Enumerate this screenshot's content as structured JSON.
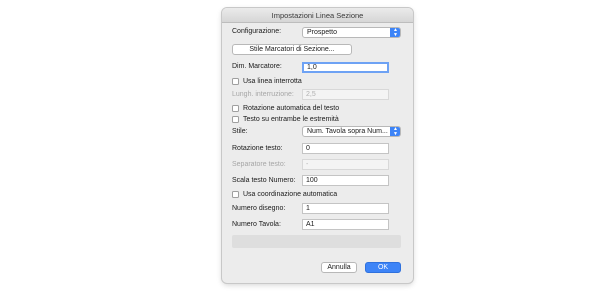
{
  "dialog": {
    "title": "Impostazioni Linea Sezione",
    "configurazione": {
      "label": "Configurazione:",
      "value": "Prospetto"
    },
    "stile_marcatori_button": "Stile Marcatori di Sezione...",
    "dim_marcatore": {
      "label": "Dim. Marcatore:",
      "value": "1,0"
    },
    "usa_linea_interrotta": {
      "label": "Usa linea interrotta",
      "checked": false
    },
    "lungh_interruzione": {
      "label": "Lungh. interruzione:",
      "value": "2,5"
    },
    "rotazione_automatica": {
      "label": "Rotazione automatica del testo",
      "checked": false
    },
    "testo_entrambe": {
      "label": "Testo su entrambe le estremità",
      "checked": false
    },
    "stile": {
      "label": "Stile:",
      "value": "Num. Tavola sopra Num..."
    },
    "rotazione_testo": {
      "label": "Rotazione testo:",
      "value": "0"
    },
    "separatore_testo": {
      "label": "Separatore testo:",
      "value": "-"
    },
    "scala_testo": {
      "label": "Scala testo Numero:",
      "value": "100"
    },
    "usa_coordinazione": {
      "label": "Usa coordinazione automatica",
      "checked": false
    },
    "numero_disegno": {
      "label": "Numero disegno:",
      "value": "1"
    },
    "numero_tavola": {
      "label": "Numero Tavola:",
      "value": "A1"
    },
    "cancel_label": "Annulla",
    "ok_label": "OK"
  },
  "icons": {
    "popup_arrows": "chevron-up-down-icon",
    "checkbox": "checkbox-icon"
  },
  "colors": {
    "accent": "#3d84f7",
    "focus_ring": "#6ea2f4",
    "dialog_bg": "#ececec"
  }
}
